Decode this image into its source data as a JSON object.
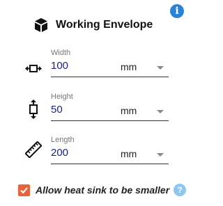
{
  "header": {
    "title": "Working Envelope",
    "info_icon": "info-icon",
    "title_icon": "cube-icon"
  },
  "fields": [
    {
      "label": "Width",
      "value": "100",
      "unit": "mm",
      "icon": "width-arrows-icon"
    },
    {
      "label": "Height",
      "value": "50",
      "unit": "mm",
      "icon": "height-arrows-icon"
    },
    {
      "label": "Length",
      "value": "200",
      "unit": "mm",
      "icon": "ruler-icon"
    }
  ],
  "heat_sink": {
    "label": "Allow heat sink to be smaller",
    "checked": true,
    "help_icon": "help-icon"
  },
  "colors": {
    "info_blue": "#2b83d6",
    "checkbox_orange": "#e8623a",
    "help_blue": "#8ec6ee",
    "value_text": "#1a237e"
  }
}
